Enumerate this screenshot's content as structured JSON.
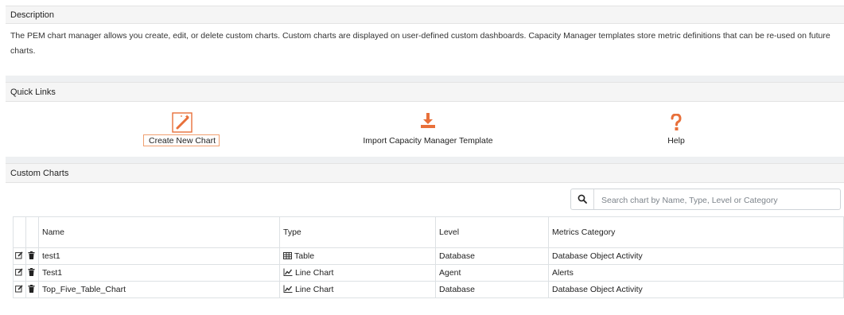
{
  "description": {
    "title": "Description",
    "text": "The PEM chart manager allows you create, edit, or delete custom charts. Custom charts are displayed on user-defined custom dashboards. Capacity Manager templates store metric definitions that can be re-used on future charts."
  },
  "quick_links": {
    "title": "Quick Links",
    "items": [
      {
        "label": "Create New Chart",
        "icon": "magic-wand-icon"
      },
      {
        "label": "Import Capacity Manager Template",
        "icon": "download-icon"
      },
      {
        "label": "Help",
        "icon": "question-mark-icon"
      }
    ]
  },
  "custom_charts": {
    "title": "Custom Charts",
    "search_placeholder": "Search chart by Name, Type, Level or Category",
    "columns": [
      "Name",
      "Type",
      "Level",
      "Metrics Category"
    ],
    "rows": [
      {
        "name": "test1",
        "type": "Table",
        "type_icon": "table-icon",
        "level": "Database",
        "category": "Database Object Activity"
      },
      {
        "name": "Test1",
        "type": "Line Chart",
        "type_icon": "line-chart-icon",
        "level": "Agent",
        "category": "Alerts"
      },
      {
        "name": "Top_Five_Table_Chart",
        "type": "Line Chart",
        "type_icon": "line-chart-icon",
        "level": "Database",
        "category": "Database Object Activity"
      }
    ]
  },
  "colors": {
    "accent": "#e8703a",
    "header_bg": "#f5f5f5",
    "border": "#dde1e4"
  }
}
